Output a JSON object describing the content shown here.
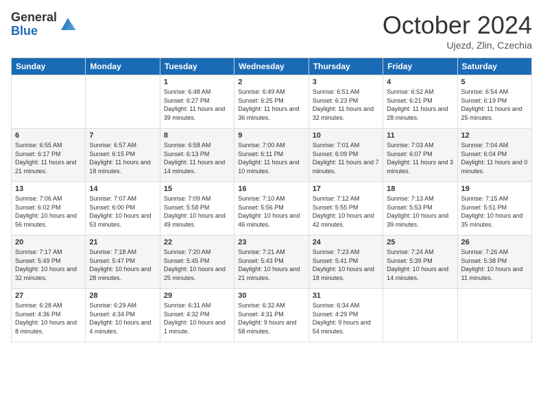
{
  "logo": {
    "general": "General",
    "blue": "Blue"
  },
  "title": "October 2024",
  "subtitle": "Ujezd, Zlin, Czechia",
  "days_header": [
    "Sunday",
    "Monday",
    "Tuesday",
    "Wednesday",
    "Thursday",
    "Friday",
    "Saturday"
  ],
  "weeks": [
    [
      {
        "day": "",
        "info": ""
      },
      {
        "day": "",
        "info": ""
      },
      {
        "day": "1",
        "info": "Sunrise: 6:48 AM\nSunset: 6:27 PM\nDaylight: 11 hours and 39 minutes."
      },
      {
        "day": "2",
        "info": "Sunrise: 6:49 AM\nSunset: 6:25 PM\nDaylight: 11 hours and 36 minutes."
      },
      {
        "day": "3",
        "info": "Sunrise: 6:51 AM\nSunset: 6:23 PM\nDaylight: 11 hours and 32 minutes."
      },
      {
        "day": "4",
        "info": "Sunrise: 6:52 AM\nSunset: 6:21 PM\nDaylight: 11 hours and 28 minutes."
      },
      {
        "day": "5",
        "info": "Sunrise: 6:54 AM\nSunset: 6:19 PM\nDaylight: 11 hours and 25 minutes."
      }
    ],
    [
      {
        "day": "6",
        "info": "Sunrise: 6:55 AM\nSunset: 6:17 PM\nDaylight: 11 hours and 21 minutes."
      },
      {
        "day": "7",
        "info": "Sunrise: 6:57 AM\nSunset: 6:15 PM\nDaylight: 11 hours and 18 minutes."
      },
      {
        "day": "8",
        "info": "Sunrise: 6:58 AM\nSunset: 6:13 PM\nDaylight: 11 hours and 14 minutes."
      },
      {
        "day": "9",
        "info": "Sunrise: 7:00 AM\nSunset: 6:11 PM\nDaylight: 11 hours and 10 minutes."
      },
      {
        "day": "10",
        "info": "Sunrise: 7:01 AM\nSunset: 6:09 PM\nDaylight: 11 hours and 7 minutes."
      },
      {
        "day": "11",
        "info": "Sunrise: 7:03 AM\nSunset: 6:07 PM\nDaylight: 11 hours and 3 minutes."
      },
      {
        "day": "12",
        "info": "Sunrise: 7:04 AM\nSunset: 6:04 PM\nDaylight: 11 hours and 0 minutes."
      }
    ],
    [
      {
        "day": "13",
        "info": "Sunrise: 7:06 AM\nSunset: 6:02 PM\nDaylight: 10 hours and 56 minutes."
      },
      {
        "day": "14",
        "info": "Sunrise: 7:07 AM\nSunset: 6:00 PM\nDaylight: 10 hours and 53 minutes."
      },
      {
        "day": "15",
        "info": "Sunrise: 7:09 AM\nSunset: 5:58 PM\nDaylight: 10 hours and 49 minutes."
      },
      {
        "day": "16",
        "info": "Sunrise: 7:10 AM\nSunset: 5:56 PM\nDaylight: 10 hours and 46 minutes."
      },
      {
        "day": "17",
        "info": "Sunrise: 7:12 AM\nSunset: 5:55 PM\nDaylight: 10 hours and 42 minutes."
      },
      {
        "day": "18",
        "info": "Sunrise: 7:13 AM\nSunset: 5:53 PM\nDaylight: 10 hours and 39 minutes."
      },
      {
        "day": "19",
        "info": "Sunrise: 7:15 AM\nSunset: 5:51 PM\nDaylight: 10 hours and 35 minutes."
      }
    ],
    [
      {
        "day": "20",
        "info": "Sunrise: 7:17 AM\nSunset: 5:49 PM\nDaylight: 10 hours and 32 minutes."
      },
      {
        "day": "21",
        "info": "Sunrise: 7:18 AM\nSunset: 5:47 PM\nDaylight: 10 hours and 28 minutes."
      },
      {
        "day": "22",
        "info": "Sunrise: 7:20 AM\nSunset: 5:45 PM\nDaylight: 10 hours and 25 minutes."
      },
      {
        "day": "23",
        "info": "Sunrise: 7:21 AM\nSunset: 5:43 PM\nDaylight: 10 hours and 21 minutes."
      },
      {
        "day": "24",
        "info": "Sunrise: 7:23 AM\nSunset: 5:41 PM\nDaylight: 10 hours and 18 minutes."
      },
      {
        "day": "25",
        "info": "Sunrise: 7:24 AM\nSunset: 5:39 PM\nDaylight: 10 hours and 14 minutes."
      },
      {
        "day": "26",
        "info": "Sunrise: 7:26 AM\nSunset: 5:38 PM\nDaylight: 10 hours and 11 minutes."
      }
    ],
    [
      {
        "day": "27",
        "info": "Sunrise: 6:28 AM\nSunset: 4:36 PM\nDaylight: 10 hours and 8 minutes."
      },
      {
        "day": "28",
        "info": "Sunrise: 6:29 AM\nSunset: 4:34 PM\nDaylight: 10 hours and 4 minutes."
      },
      {
        "day": "29",
        "info": "Sunrise: 6:31 AM\nSunset: 4:32 PM\nDaylight: 10 hours and 1 minute."
      },
      {
        "day": "30",
        "info": "Sunrise: 6:32 AM\nSunset: 4:31 PM\nDaylight: 9 hours and 58 minutes."
      },
      {
        "day": "31",
        "info": "Sunrise: 6:34 AM\nSunset: 4:29 PM\nDaylight: 9 hours and 54 minutes."
      },
      {
        "day": "",
        "info": ""
      },
      {
        "day": "",
        "info": ""
      }
    ]
  ]
}
